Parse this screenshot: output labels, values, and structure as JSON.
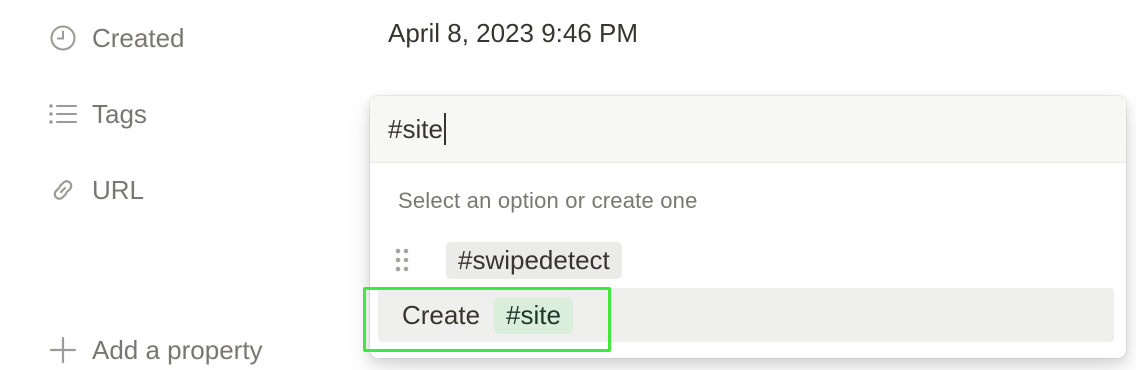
{
  "properties": [
    {
      "label": "Created",
      "icon": "clock-icon",
      "value": "April 8, 2023 9:46 PM"
    },
    {
      "label": "Tags",
      "icon": "list-icon"
    },
    {
      "label": "URL",
      "icon": "link-icon"
    }
  ],
  "add_property_label": "Add a property",
  "dropdown": {
    "search_value": "#site",
    "hint": "Select an option or create one",
    "options": [
      {
        "label": "#swipedetect"
      }
    ],
    "create_label": "Create",
    "create_value": "#site"
  },
  "colors": {
    "new_tag_bg": "#dbeddb",
    "existing_tag_bg": "#ebebea",
    "highlight": "#3ee840"
  }
}
